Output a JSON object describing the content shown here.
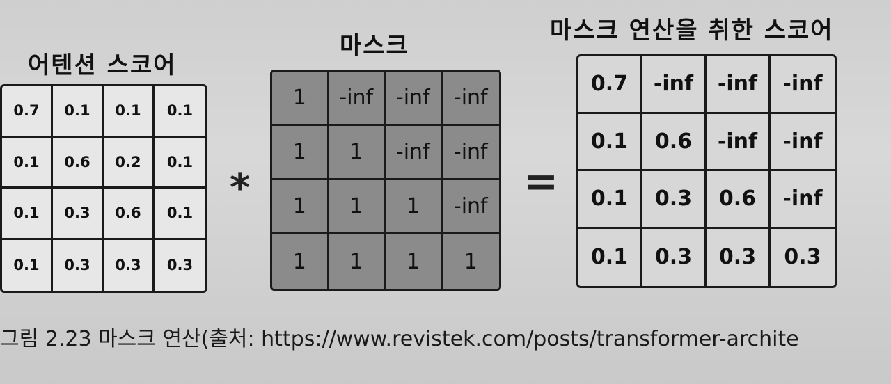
{
  "labels": {
    "attention_score": "어텐션 스코어",
    "mask": "마스크",
    "masked_score": "마스크 연산을 취한 스코어"
  },
  "operators": {
    "multiply": "*",
    "equals": "="
  },
  "matrices": {
    "attention": [
      [
        "0.7",
        "0.1",
        "0.1",
        "0.1"
      ],
      [
        "0.1",
        "0.6",
        "0.2",
        "0.1"
      ],
      [
        "0.1",
        "0.3",
        "0.6",
        "0.1"
      ],
      [
        "0.1",
        "0.3",
        "0.3",
        "0.3"
      ]
    ],
    "mask": [
      [
        "1",
        "-inf",
        "-inf",
        "-inf"
      ],
      [
        "1",
        "1",
        "-inf",
        "-inf"
      ],
      [
        "1",
        "1",
        "1",
        "-inf"
      ],
      [
        "1",
        "1",
        "1",
        "1"
      ]
    ],
    "result": [
      [
        "0.7",
        "-inf",
        "-inf",
        "-inf"
      ],
      [
        "0.1",
        "0.6",
        "-inf",
        "-inf"
      ],
      [
        "0.1",
        "0.3",
        "0.6",
        "-inf"
      ],
      [
        "0.1",
        "0.3",
        "0.3",
        "0.3"
      ]
    ]
  },
  "caption": "그림 2.23 마스크 연산(출처: https://www.revistek.com/posts/transformer-archite"
}
